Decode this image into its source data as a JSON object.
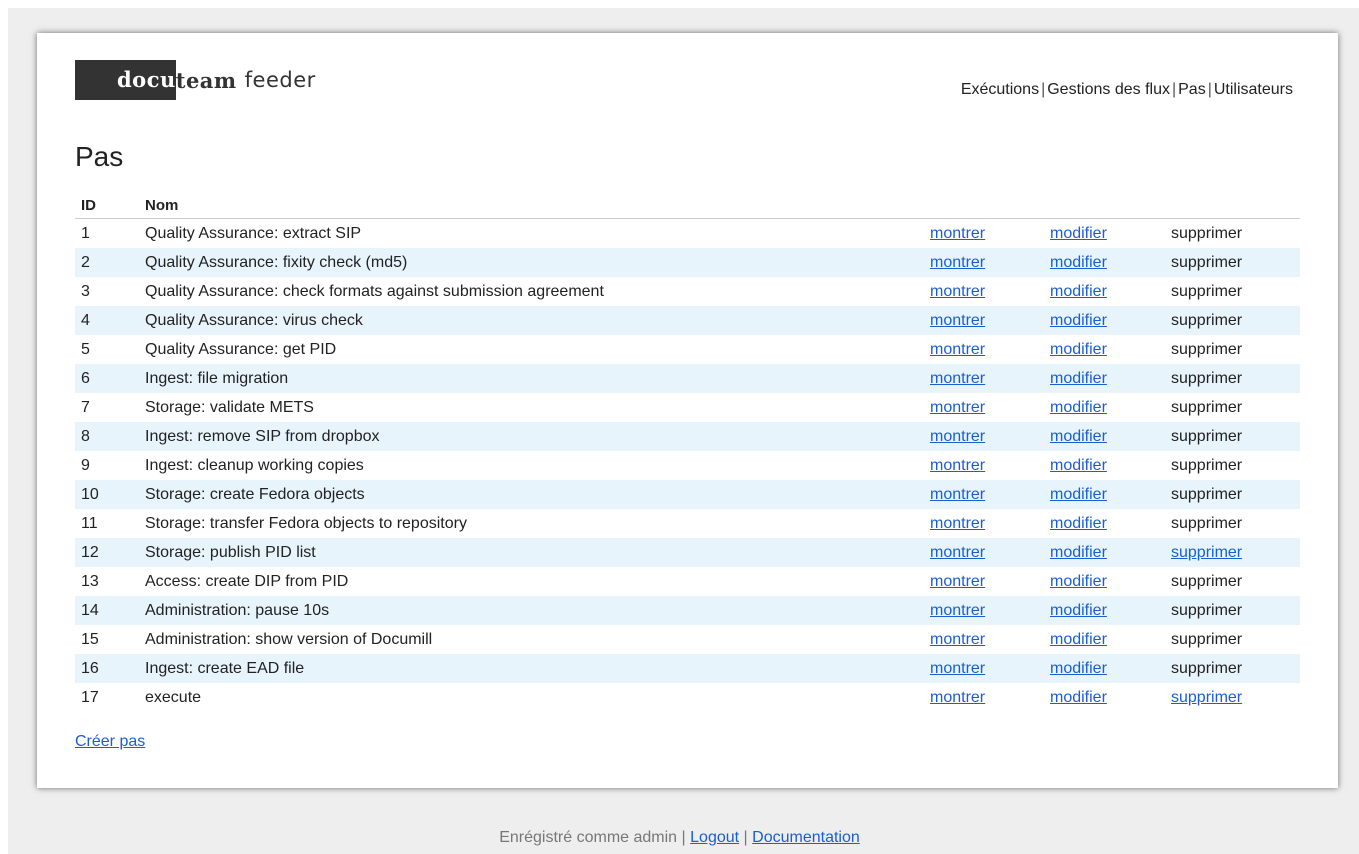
{
  "logo": {
    "docu": "docu",
    "team": "team",
    "feeder": "feeder"
  },
  "nav": [
    {
      "label": "Exécutions"
    },
    {
      "label": "Gestions des flux"
    },
    {
      "label": "Pas"
    },
    {
      "label": "Utilisateurs"
    }
  ],
  "page_title": "Pas",
  "table": {
    "headers": {
      "id": "ID",
      "name": "Nom"
    },
    "action_labels": {
      "show": "montrer",
      "edit": "modifier",
      "delete": "supprimer"
    },
    "rows": [
      {
        "id": "1",
        "name": "Quality Assurance: extract SIP",
        "delete_link": false
      },
      {
        "id": "2",
        "name": "Quality Assurance: fixity check (md5)",
        "delete_link": false
      },
      {
        "id": "3",
        "name": "Quality Assurance: check formats against submission agreement",
        "delete_link": false
      },
      {
        "id": "4",
        "name": "Quality Assurance: virus check",
        "delete_link": false
      },
      {
        "id": "5",
        "name": "Quality Assurance: get PID",
        "delete_link": false
      },
      {
        "id": "6",
        "name": "Ingest: file migration",
        "delete_link": false
      },
      {
        "id": "7",
        "name": "Storage: validate METS",
        "delete_link": false
      },
      {
        "id": "8",
        "name": "Ingest: remove SIP from dropbox",
        "delete_link": false
      },
      {
        "id": "9",
        "name": "Ingest: cleanup working copies",
        "delete_link": false
      },
      {
        "id": "10",
        "name": "Storage: create Fedora objects",
        "delete_link": false
      },
      {
        "id": "11",
        "name": "Storage: transfer Fedora objects to repository",
        "delete_link": false
      },
      {
        "id": "12",
        "name": "Storage: publish PID list",
        "delete_link": true
      },
      {
        "id": "13",
        "name": "Access: create DIP from PID",
        "delete_link": false
      },
      {
        "id": "14",
        "name": "Administration: pause 10s",
        "delete_link": false
      },
      {
        "id": "15",
        "name": "Administration: show version of Documill",
        "delete_link": false
      },
      {
        "id": "16",
        "name": "Ingest: create EAD file",
        "delete_link": false
      },
      {
        "id": "17",
        "name": "execute",
        "delete_link": true
      }
    ]
  },
  "create_link": "Créer pas",
  "footer": {
    "registered_text": "Enrégistré comme admin",
    "logout": "Logout",
    "documentation": "Documentation"
  },
  "colors": {
    "link": "#1a5fd0",
    "row_alt": "#e7f4fc",
    "logo_bg": "#333333"
  }
}
